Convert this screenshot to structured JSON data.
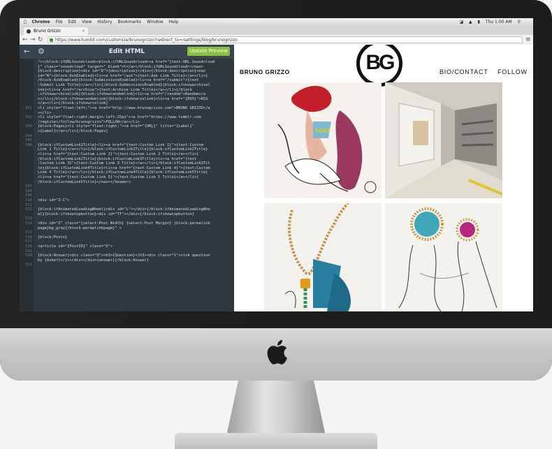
{
  "mac_menu": {
    "app": "Chrome",
    "items": [
      "File",
      "Edit",
      "View",
      "History",
      "Bookmarks",
      "Window",
      "Help"
    ],
    "clock": "Thu 1:00 AM"
  },
  "browser": {
    "tab_title": "Bruno Grizzo",
    "url": "https://www.tumblr.com/customize/brunogrizzo?redirect_to=/settings/blog/brunogrizzo"
  },
  "editor": {
    "title": "Edit HTML",
    "update_button": "Update Preview",
    "lines": [
      {
        "n": "",
        "t": "\"></block:ifURLSoundcloud><block:ifURLSoundcloud><a href=\"{text:URL Soundcloud"
      },
      {
        "n": "",
        "t": "}\" class=\"soundcloud\" target=\"_blank\">t</a></block:ifURLSoundcloud></nav>"
      },
      {
        "n": "",
        "t": "{block:description}<div id=\"D\">{description}</div>{/block:description}<nav"
      },
      {
        "n": "",
        "t": "id=\"N\">{block:AskEnabled}<li><a href=\"/ask\">{text:Ask Link Title}</a></li>{"
      },
      {
        "n": "",
        "t": "/block:AskEnabled}{block:SubmissionsEnabled}<li><a href=\"/submit\">{text"
      },
      {
        "n": "",
        "t": ":Submit Link Title}</a></li>{/block:SubmissionsEnabled}{block:ifshowarchivel"
      },
      {
        "n": "",
        "t": "ink}<li><a href=\"/archive\">{text:Archive Link Title}</a></li>{/block"
      },
      {
        "n": "",
        "t": ":ifshowarchivelink}{block:ifshowrandomlink}<li><a href=\"/random\">Random</a"
      },
      {
        "n": "",
        "t": "></li>{/block:ifshowrandomlink}{block:ifshowrsslink}<li><a href=\"{RSS}\">RSS"
      },
      {
        "n": "",
        "t": "</a></li>{/block:ifshowrsslink}"
      },
      {
        "n": "501",
        "t": "<li style=\"float:left;\"><a href=\"http://www.brunogrizzo.com\">BRUNO GRIZZO</a"
      },
      {
        "n": "",
        "t": "></li>"
      },
      {
        "n": "502",
        "t": "<li style=\"float:right;margin-left:25px\"><a href=\"https://www.tumblr.com"
      },
      {
        "n": "",
        "t": "/register/follow/brunogrizzo\">FOLLOW</a></li>"
      },
      {
        "n": "503",
        "t": "{block:Pages}<li style=\"float:right;\"><a href=\"{URL}\" title=\"{Label}\""
      },
      {
        "n": "",
        "t": ">{Label}</a></li>{/block:Pages}"
      },
      {
        "n": "504",
        "t": ""
      },
      {
        "n": "505",
        "t": ""
      },
      {
        "n": "506",
        "t": "{block:ifCustomLink1Title}<li><a href=\"{text:Custom Link 1}\">{text:Custom"
      },
      {
        "n": "",
        "t": "Link 1 Title}</a></li>{/block:ifCustomLink1Title}{block:ifCustomLink2Title}"
      },
      {
        "n": "",
        "t": "<li><a href=\"{text:Custom Link 2}\">{text:Custom Link 2 Title}</a></li>{"
      },
      {
        "n": "",
        "t": "/block:ifCustomLink2Title}{block:ifCustomLink3Title}<li><a href=\"{text"
      },
      {
        "n": "",
        "t": ":Custom Link 3}\">{text:Custom Link 3 Title}</a></li>{/block:ifCustomLink3Tit"
      },
      {
        "n": "",
        "t": "le}{block:ifCustomLink4Title}<li><a href=\"{text:Custom Link 4}\">{text:Custom"
      },
      {
        "n": "",
        "t": "Link 4 Title}</a></li>{/block:ifCustomLink4Title}{block:ifCustomLink5Title}"
      },
      {
        "n": "",
        "t": "<li><a href=\"{text:Custom Link 5}\">{text:Custom Link 5 Title}</a></li>{"
      },
      {
        "n": "",
        "t": "/block:ifCustomLink5Title}</nav></header>"
      },
      {
        "n": "507",
        "t": ""
      },
      {
        "n": "508",
        "t": ""
      },
      {
        "n": "509",
        "t": ""
      },
      {
        "n": "510",
        "t": "<div id=\"Z-C\">"
      },
      {
        "n": "511",
        "t": ""
      },
      {
        "n": "512",
        "t": "{block:ifAnimatedLoadingWheel}<div id=\"L\"></div>{/block:ifAnimatedLoadingWhe"
      },
      {
        "n": "",
        "t": "el}{block:ifshowtopbutton}<div id=\"TT\"></div>{/block:ifshowtopbutton}"
      },
      {
        "n": "513",
        "t": ""
      },
      {
        "n": "514",
        "t": "<div id=\"Z\" class=\"{select:Post Width} {select:Post Margin} {block:permalink"
      },
      {
        "n": "",
        "t": "page}bg_gray{/block:permalinkpage}\" >"
      },
      {
        "n": "515",
        "t": ""
      },
      {
        "n": "516",
        "t": "{block:Posts}"
      },
      {
        "n": "517",
        "t": ""
      },
      {
        "n": "518",
        "t": "<article id=\"{PostID}\" class=\"X\">"
      },
      {
        "n": "519",
        "t": ""
      },
      {
        "n": "520",
        "t": "{block:Answer}<div class=\"Q\"><h3>{Question}</h3><div class=\"S\"><i>A question"
      },
      {
        "n": "",
        "t": "by {Asker}</i></div></div>{answer}{/block:Answer}"
      },
      {
        "n": "521",
        "t": ""
      }
    ]
  },
  "blog": {
    "logo_text": "BG",
    "brand": "BRUNO GRIZZO",
    "nav": [
      "BIO/CONTACT",
      "FOLLOW"
    ],
    "photo_caption": "FOXY"
  },
  "colors": {
    "editor_bg": "#2e3840",
    "editor_header": "#384450",
    "update_green": "#8bbf3f"
  }
}
